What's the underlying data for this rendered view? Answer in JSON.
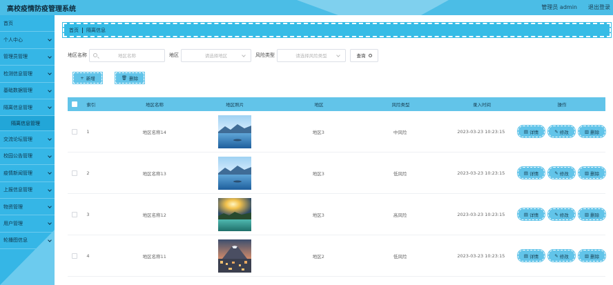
{
  "header": {
    "title": "高校疫情防疫管理系统",
    "user_label": "管理员 admin",
    "logout": "退出登录"
  },
  "sidebar": {
    "items": [
      {
        "label": "首页",
        "chevron": false
      },
      {
        "label": "个人中心",
        "chevron": true
      },
      {
        "label": "管理员管理",
        "chevron": true
      },
      {
        "label": "检测信息管理",
        "chevron": true
      },
      {
        "label": "基础数据管理",
        "chevron": true
      },
      {
        "label": "隔离信息管理",
        "chevron": true
      },
      {
        "label": "交流论坛管理",
        "chevron": true
      },
      {
        "label": "校园公告管理",
        "chevron": true
      },
      {
        "label": "疫情新闻管理",
        "chevron": true
      },
      {
        "label": "上报信息管理",
        "chevron": true
      },
      {
        "label": "物资管理",
        "chevron": true
      },
      {
        "label": "用户管理",
        "chevron": true
      },
      {
        "label": "轮播图信息",
        "chevron": true
      }
    ],
    "active_sub": "隔离信息管理"
  },
  "breadcrumb": {
    "home": "首页",
    "current": "隔离信息"
  },
  "filters": {
    "name_label": "地区名称",
    "name_placeholder": "地区名称",
    "area_label": "地区",
    "area_placeholder": "请选择地区",
    "risk_label": "风险类型",
    "risk_placeholder": "请选择风险类型",
    "query_label": "查询"
  },
  "actions": {
    "add": "新增",
    "delete": "删除"
  },
  "table": {
    "headers": {
      "index": "索引",
      "name": "地区名称",
      "photo": "地区照片",
      "area": "地区",
      "risk": "风险类型",
      "time": "录入时间",
      "ops": "操作"
    },
    "rows": [
      {
        "index": "1",
        "name": "地区名称14",
        "area": "地区3",
        "risk": "中风险",
        "time": "2023-03-23 10:23:15",
        "photo": "lake-mountain"
      },
      {
        "index": "2",
        "name": "地区名称13",
        "area": "地区3",
        "risk": "低风险",
        "time": "2023-03-23 10:23:15",
        "photo": "lake-mountain"
      },
      {
        "index": "3",
        "name": "地区名称12",
        "area": "地区3",
        "risk": "高风险",
        "time": "2023-03-23 10:23:15",
        "photo": "sunset-lake"
      },
      {
        "index": "4",
        "name": "地区名称11",
        "area": "地区2",
        "risk": "低风险",
        "time": "2023-03-23 10:23:15",
        "photo": "city-volcano"
      }
    ],
    "row_ops": {
      "detail": "详情",
      "edit": "修改",
      "delete": "删除"
    }
  }
}
